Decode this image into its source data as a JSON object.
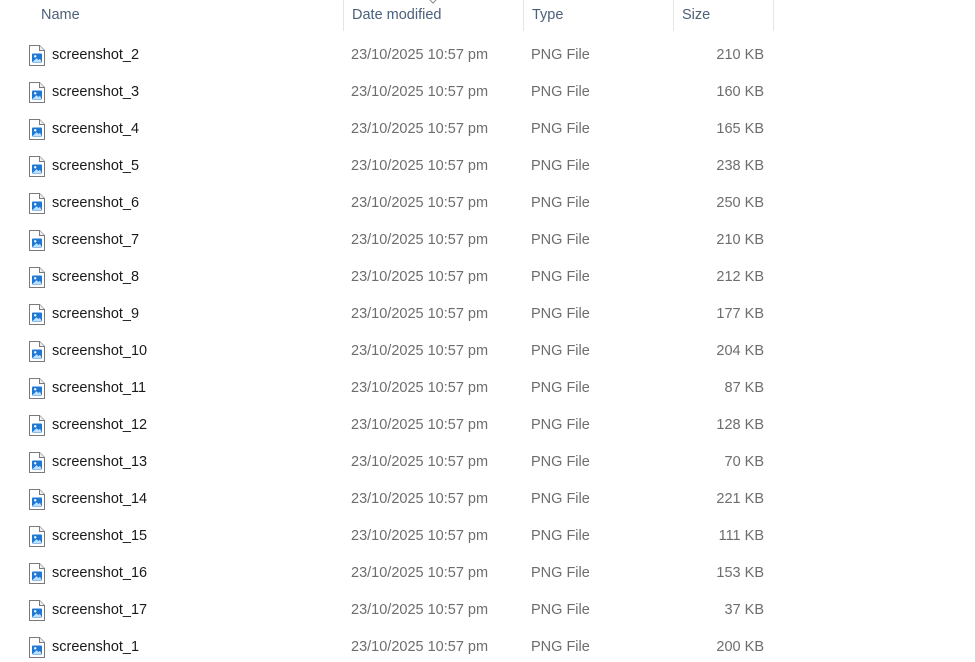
{
  "columns": {
    "name": "Name",
    "date_modified": "Date modified",
    "type": "Type",
    "size": "Size"
  },
  "sort": {
    "column": "date_modified",
    "indicator": "chevron-down-icon"
  },
  "file_icon": "png-image-file-icon",
  "colors": {
    "header_text": "#4c607a",
    "name_text": "#1a1a1a",
    "detail_text": "#6d6d6d",
    "icon_accent": "#1e78d4"
  },
  "files": [
    {
      "name": "screenshot_2",
      "date": "23/10/2025 10:57 pm",
      "type": "PNG File",
      "size": "210 KB"
    },
    {
      "name": "screenshot_3",
      "date": "23/10/2025 10:57 pm",
      "type": "PNG File",
      "size": "160 KB"
    },
    {
      "name": "screenshot_4",
      "date": "23/10/2025 10:57 pm",
      "type": "PNG File",
      "size": "165 KB"
    },
    {
      "name": "screenshot_5",
      "date": "23/10/2025 10:57 pm",
      "type": "PNG File",
      "size": "238 KB"
    },
    {
      "name": "screenshot_6",
      "date": "23/10/2025 10:57 pm",
      "type": "PNG File",
      "size": "250 KB"
    },
    {
      "name": "screenshot_7",
      "date": "23/10/2025 10:57 pm",
      "type": "PNG File",
      "size": "210 KB"
    },
    {
      "name": "screenshot_8",
      "date": "23/10/2025 10:57 pm",
      "type": "PNG File",
      "size": "212 KB"
    },
    {
      "name": "screenshot_9",
      "date": "23/10/2025 10:57 pm",
      "type": "PNG File",
      "size": "177 KB"
    },
    {
      "name": "screenshot_10",
      "date": "23/10/2025 10:57 pm",
      "type": "PNG File",
      "size": "204 KB"
    },
    {
      "name": "screenshot_11",
      "date": "23/10/2025 10:57 pm",
      "type": "PNG File",
      "size": "87 KB"
    },
    {
      "name": "screenshot_12",
      "date": "23/10/2025 10:57 pm",
      "type": "PNG File",
      "size": "128 KB"
    },
    {
      "name": "screenshot_13",
      "date": "23/10/2025 10:57 pm",
      "type": "PNG File",
      "size": "70 KB"
    },
    {
      "name": "screenshot_14",
      "date": "23/10/2025 10:57 pm",
      "type": "PNG File",
      "size": "221 KB"
    },
    {
      "name": "screenshot_15",
      "date": "23/10/2025 10:57 pm",
      "type": "PNG File",
      "size": "111 KB"
    },
    {
      "name": "screenshot_16",
      "date": "23/10/2025 10:57 pm",
      "type": "PNG File",
      "size": "153 KB"
    },
    {
      "name": "screenshot_17",
      "date": "23/10/2025 10:57 pm",
      "type": "PNG File",
      "size": "37 KB"
    },
    {
      "name": "screenshot_1",
      "date": "23/10/2025 10:57 pm",
      "type": "PNG File",
      "size": "200 KB"
    }
  ]
}
